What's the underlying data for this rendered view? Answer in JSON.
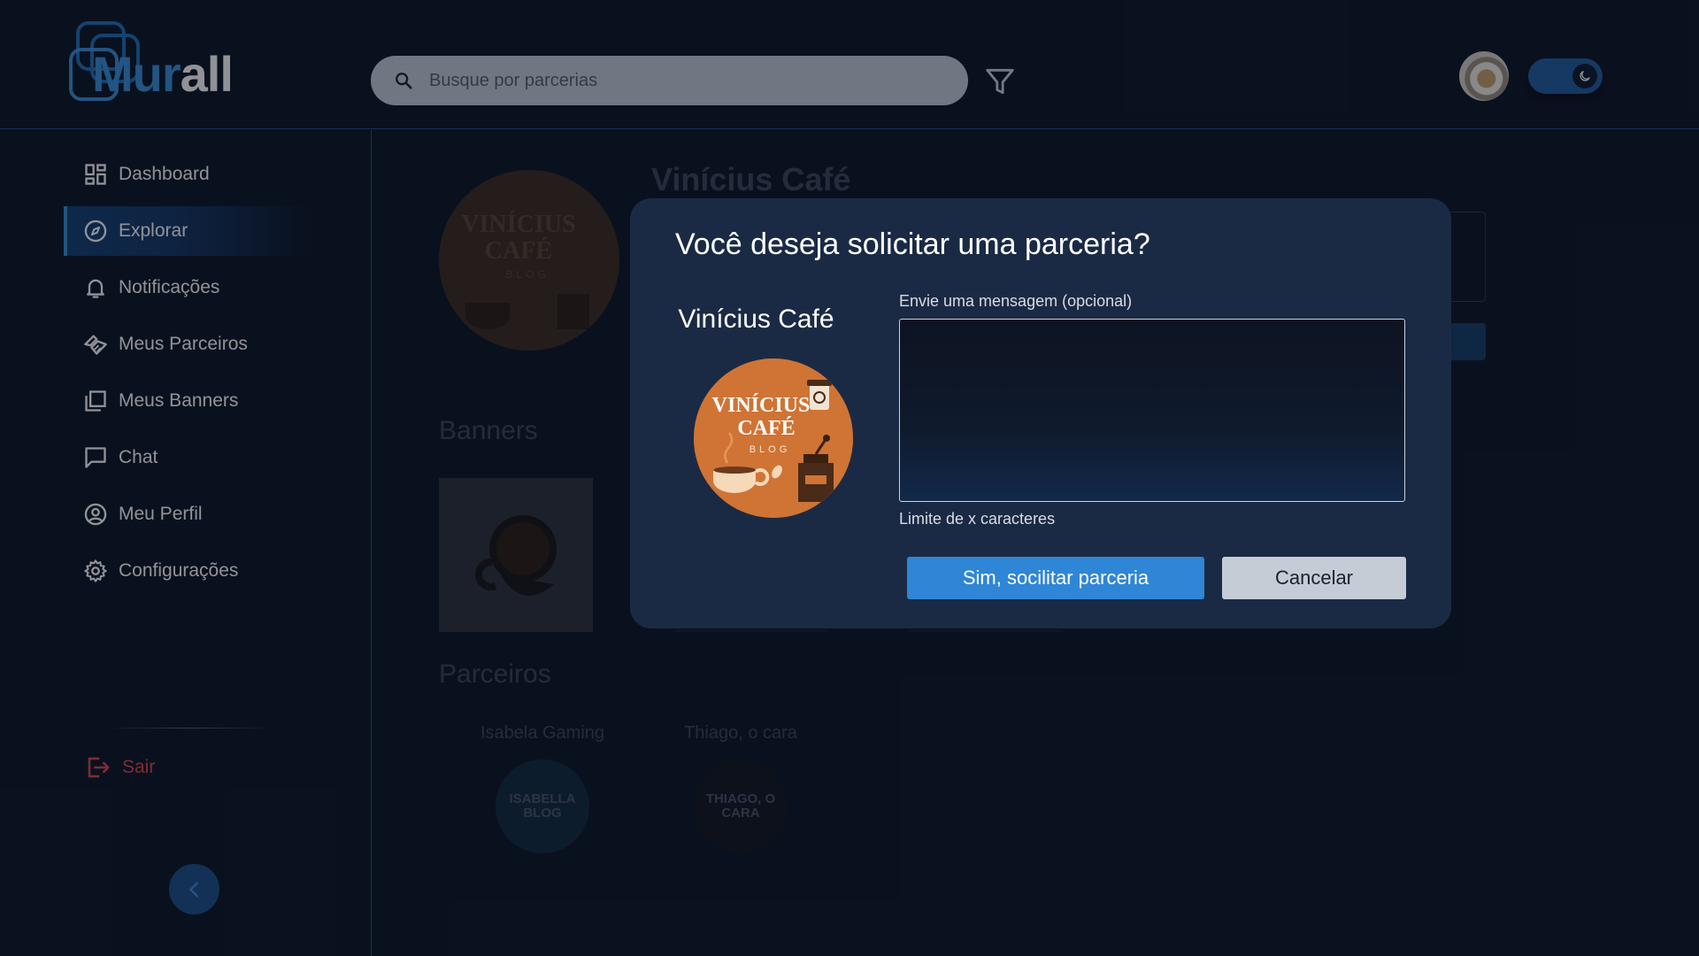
{
  "app": {
    "brand": {
      "m": "M",
      "ur": "ur",
      "all": "all"
    }
  },
  "header": {
    "search_placeholder": "Busque por parcerias",
    "icons": {
      "search": "search-icon",
      "filter": "filter-icon",
      "theme": "moon-icon"
    },
    "theme_mode": "dark"
  },
  "sidebar": {
    "items": [
      {
        "label": "Dashboard",
        "icon": "dashboard-icon",
        "active": false
      },
      {
        "label": "Explorar",
        "icon": "compass-icon",
        "active": true
      },
      {
        "label": "Notificações",
        "icon": "bell-icon",
        "active": false
      },
      {
        "label": "Meus Parceiros",
        "icon": "handshake-icon",
        "active": false
      },
      {
        "label": "Meus Banners",
        "icon": "banners-icon",
        "active": false
      },
      {
        "label": "Chat",
        "icon": "chat-icon",
        "active": false
      },
      {
        "label": "Meu Perfil",
        "icon": "user-circle-icon",
        "active": false
      },
      {
        "label": "Configurações",
        "icon": "gear-icon",
        "active": false
      }
    ],
    "logout_label": "Sair"
  },
  "page": {
    "profile_name": "Vinícius Café",
    "banners_title": "Banners",
    "partners_title": "Parceiros",
    "partners": [
      {
        "name": "Isabela Gaming",
        "logo_text": "ISABELLA BLOG"
      },
      {
        "name": "Thiago, o cara",
        "logo_text": "THIAGO, O CARA"
      }
    ]
  },
  "modal": {
    "title": "Você deseja solicitar uma parceria?",
    "partner_name": "Vinícius Café",
    "partner_logo": {
      "line1": "VINÍCIUS",
      "line2": "CAFÉ",
      "line3": "BLOG"
    },
    "message_label": "Envie uma mensagem (opcional)",
    "message_value": "",
    "message_hint": "Limite de x caracteres",
    "confirm_label": "Sim, socilitar parceria",
    "cancel_label": "Cancelar"
  },
  "colors": {
    "background": "#0c1424",
    "accent": "#3a8fd9",
    "modal": "#1b2a44",
    "confirm": "#2f86d6",
    "danger": "#e0454a"
  }
}
